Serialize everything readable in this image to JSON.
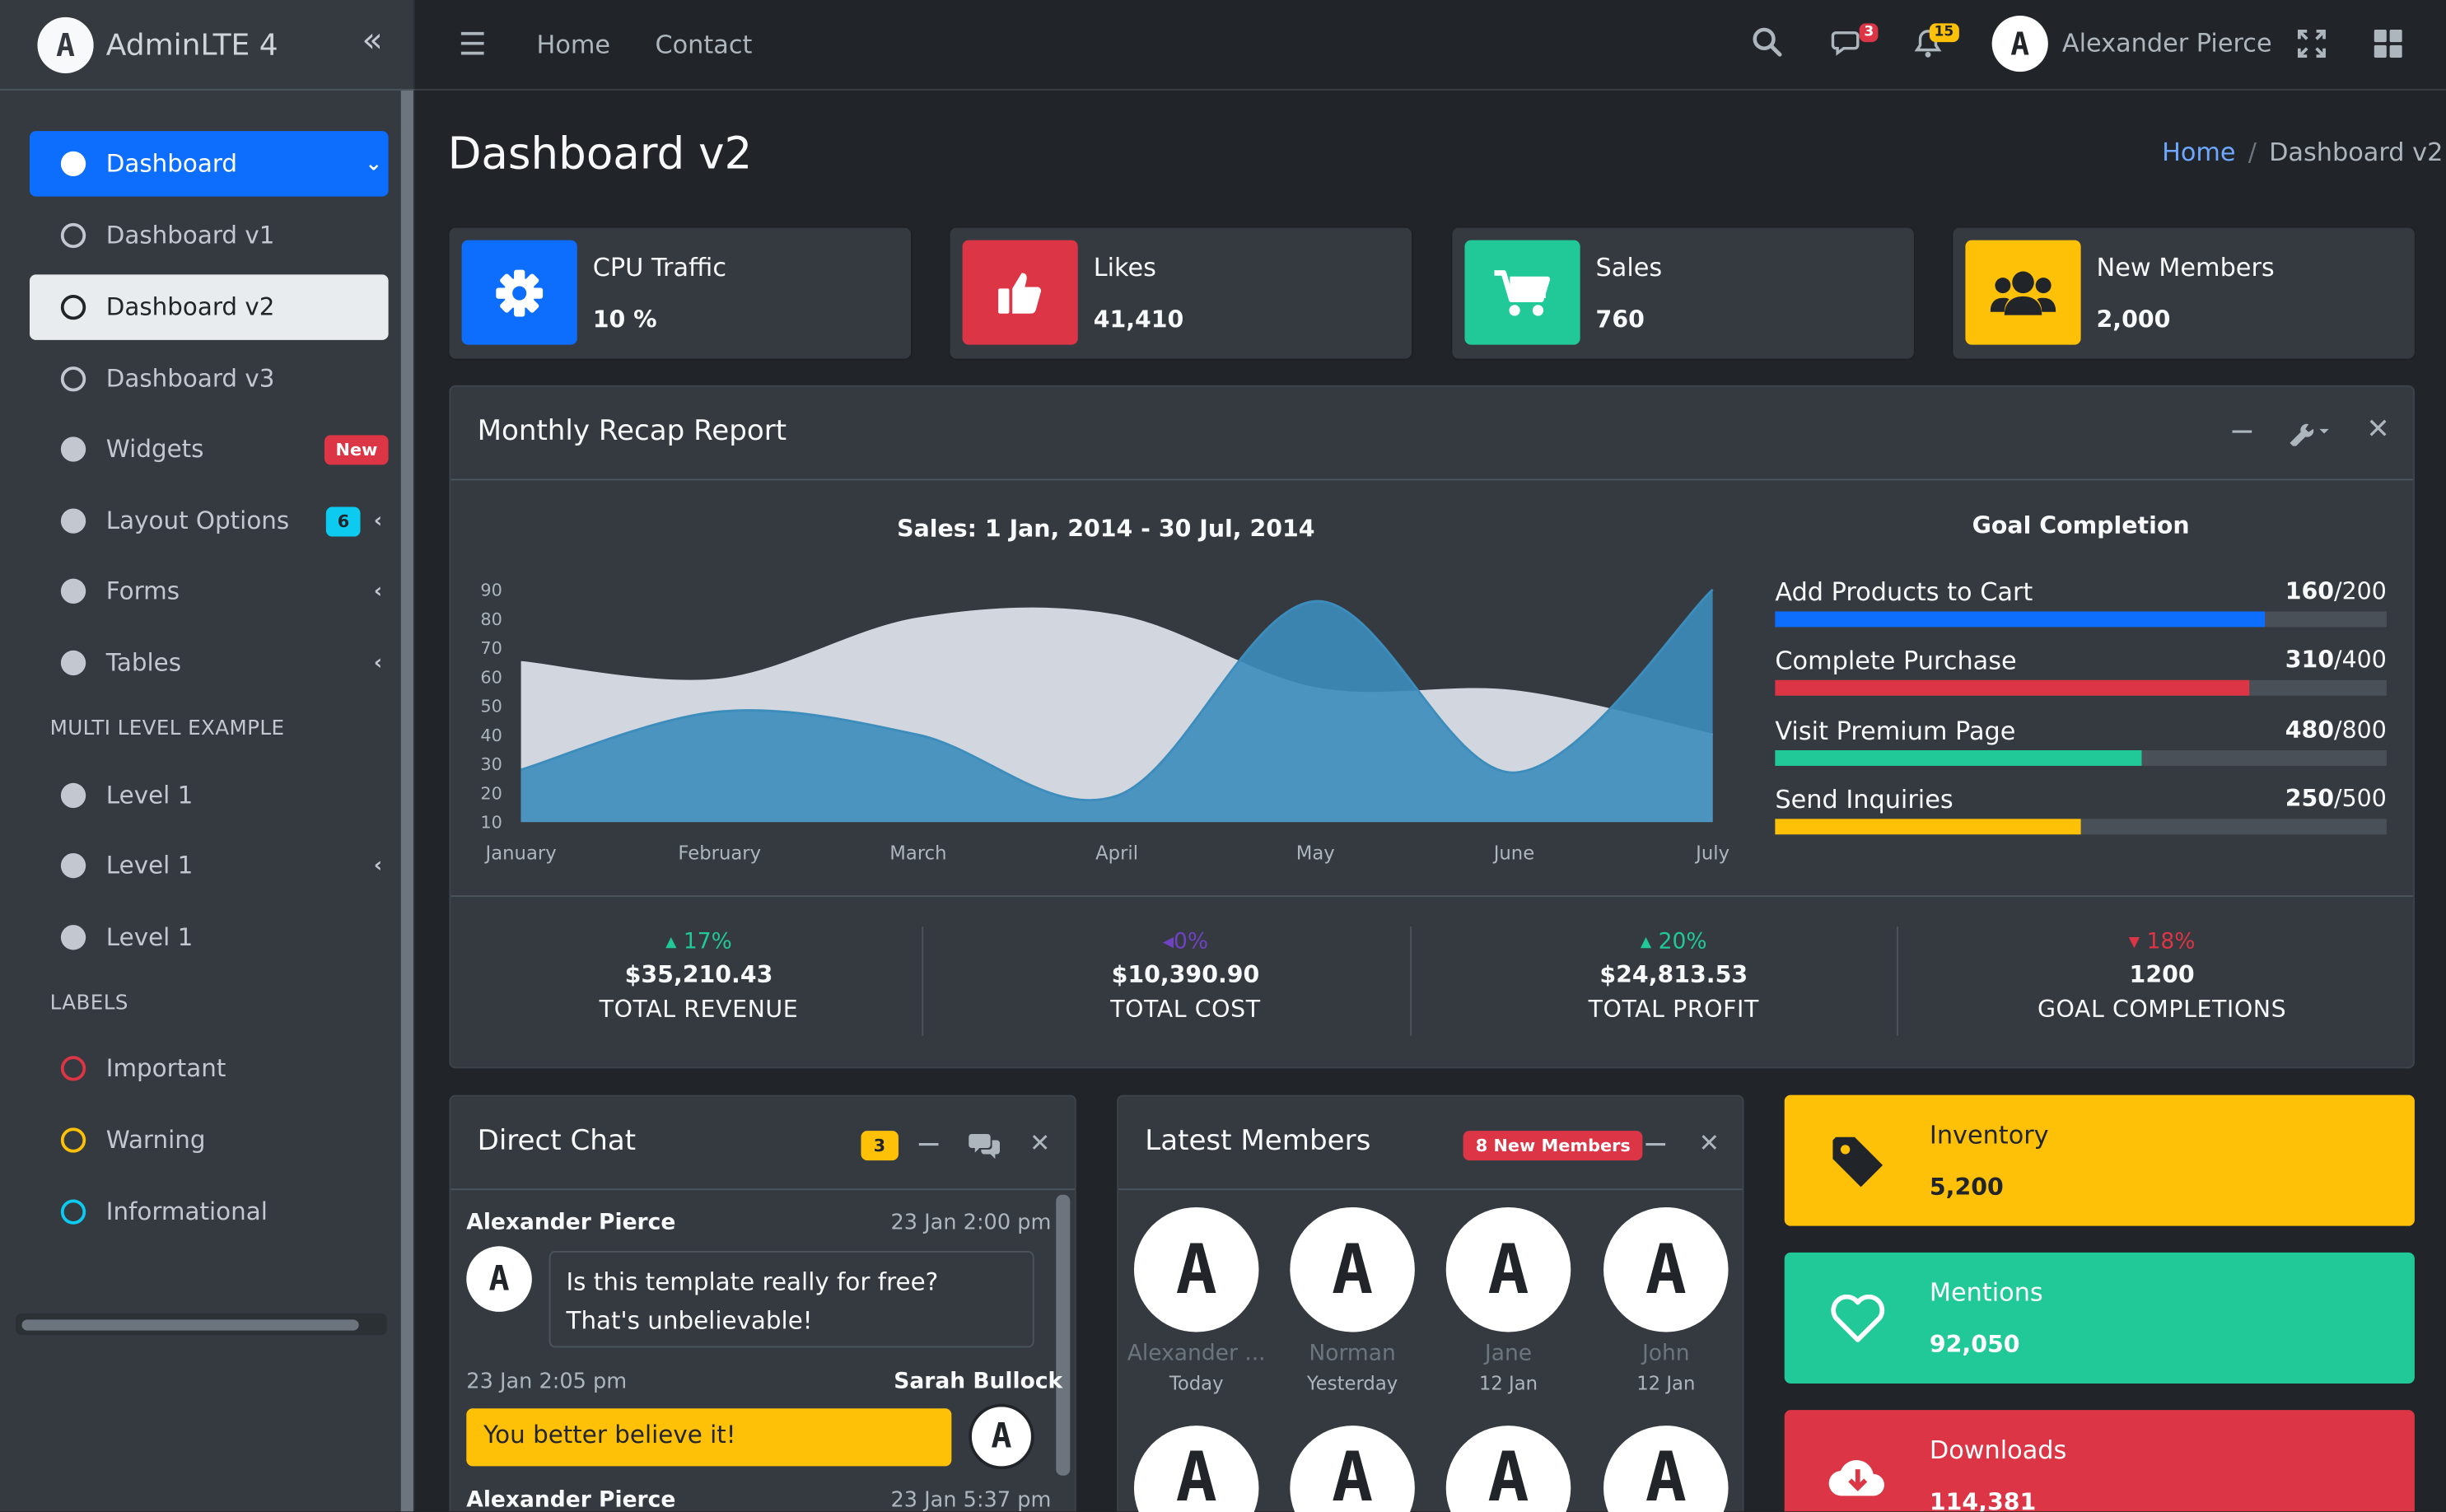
{
  "brand": {
    "name": "AdminLTE 4"
  },
  "topbar": {
    "links": [
      "Home",
      "Contact"
    ],
    "messages_badge": "3",
    "notifications_badge": "15",
    "user_name": "Alexander Pierce"
  },
  "sidebar": {
    "items": [
      {
        "label": "Dashboard"
      },
      {
        "label": "Dashboard v1"
      },
      {
        "label": "Dashboard v2"
      },
      {
        "label": "Dashboard v3"
      },
      {
        "label": "Widgets",
        "badge": "New"
      },
      {
        "label": "Layout Options",
        "badge": "6"
      },
      {
        "label": "Forms"
      },
      {
        "label": "Tables"
      }
    ],
    "multi_header": "MULTI LEVEL EXAMPLE",
    "levels": [
      "Level 1",
      "Level 1",
      "Level 1"
    ],
    "labels_header": "LABELS",
    "labels": [
      {
        "label": "Important",
        "color": "#dc3545"
      },
      {
        "label": "Warning",
        "color": "#ffc107"
      },
      {
        "label": "Informational",
        "color": "#0dcaf0"
      }
    ]
  },
  "page": {
    "title": "Dashboard v2",
    "breadcrumb": {
      "home": "Home",
      "current": "Dashboard v2"
    }
  },
  "info_boxes": [
    {
      "label": "CPU Traffic",
      "value": "10 %",
      "icon": "gear-icon",
      "color": "#0d6efd"
    },
    {
      "label": "Likes",
      "value": "41,410",
      "icon": "thumbs-up-icon",
      "color": "#dc3545"
    },
    {
      "label": "Sales",
      "value": "760",
      "icon": "cart-icon",
      "color": "#20c997"
    },
    {
      "label": "New Members",
      "value": "2,000",
      "icon": "users-icon",
      "color": "#ffc107"
    }
  ],
  "recap": {
    "title": "Monthly Recap Report",
    "goal_title": "Goal Completion",
    "goals": [
      {
        "label": "Add Products to Cart",
        "current": "160",
        "total": "/200",
        "fraction": 0.8,
        "color": "#0d6efd"
      },
      {
        "label": "Complete Purchase",
        "current": "310",
        "total": "/400",
        "fraction": 0.775,
        "color": "#dc3545"
      },
      {
        "label": "Visit Premium Page",
        "current": "480",
        "total": "/800",
        "fraction": 0.6,
        "color": "#20c997"
      },
      {
        "label": "Send Inquiries",
        "current": "250",
        "total": "/500",
        "fraction": 0.5,
        "color": "#ffc107"
      }
    ],
    "stats": [
      {
        "pct": "17%",
        "dir": "up",
        "amount": "$35,210.43",
        "label": "TOTAL REVENUE",
        "color": "#20c997"
      },
      {
        "pct": "0%",
        "dir": "left",
        "amount": "$10,390.90",
        "label": "TOTAL COST",
        "color": "#6f42c1"
      },
      {
        "pct": "20%",
        "dir": "up",
        "amount": "$24,813.53",
        "label": "TOTAL PROFIT",
        "color": "#20c997"
      },
      {
        "pct": "18%",
        "dir": "down",
        "amount": "1200",
        "label": "GOAL COMPLETIONS",
        "color": "#dc3545"
      }
    ]
  },
  "chart_data": {
    "type": "area",
    "title": "Sales: 1 Jan, 2014 - 30 Jul, 2014",
    "categories": [
      "January",
      "February",
      "March",
      "April",
      "May",
      "June",
      "July"
    ],
    "series": [
      {
        "values": [
          28,
          48,
          40,
          19,
          86,
          27,
          90
        ],
        "color": "#3c8dbc"
      },
      {
        "values": [
          65,
          59,
          80,
          81,
          56,
          55,
          40
        ],
        "color": "#d2d6de"
      }
    ],
    "yticks": [
      10,
      20,
      30,
      40,
      50,
      60,
      70,
      80,
      90
    ],
    "ylim": [
      10,
      90
    ],
    "grid": false
  },
  "chat": {
    "title": "Direct Chat",
    "badge": "3",
    "messages": [
      {
        "name": "Alexander Pierce",
        "time": "23 Jan 2:00 pm",
        "text": "Is this template really for free? That's unbelievable!"
      },
      {
        "name": "Sarah Bullock",
        "time": "23 Jan 2:05 pm",
        "text": "You better believe it!"
      },
      {
        "name": "Alexander Pierce",
        "time": "23 Jan 5:37 pm"
      }
    ]
  },
  "members": {
    "title": "Latest Members",
    "badge": "8 New Members",
    "list": [
      {
        "name": "Alexander ...",
        "date": "Today"
      },
      {
        "name": "Norman",
        "date": "Yesterday"
      },
      {
        "name": "Jane",
        "date": "12 Jan"
      },
      {
        "name": "John",
        "date": "12 Jan"
      }
    ]
  },
  "side_boxes": [
    {
      "label": "Inventory",
      "value": "5,200",
      "color": "#ffc107",
      "icon": "tag-icon"
    },
    {
      "label": "Mentions",
      "value": "92,050",
      "color": "#20c997",
      "icon": "heart-icon"
    },
    {
      "label": "Downloads",
      "value": "114,381",
      "color": "#dc3545",
      "icon": "cloud-download-icon"
    }
  ]
}
